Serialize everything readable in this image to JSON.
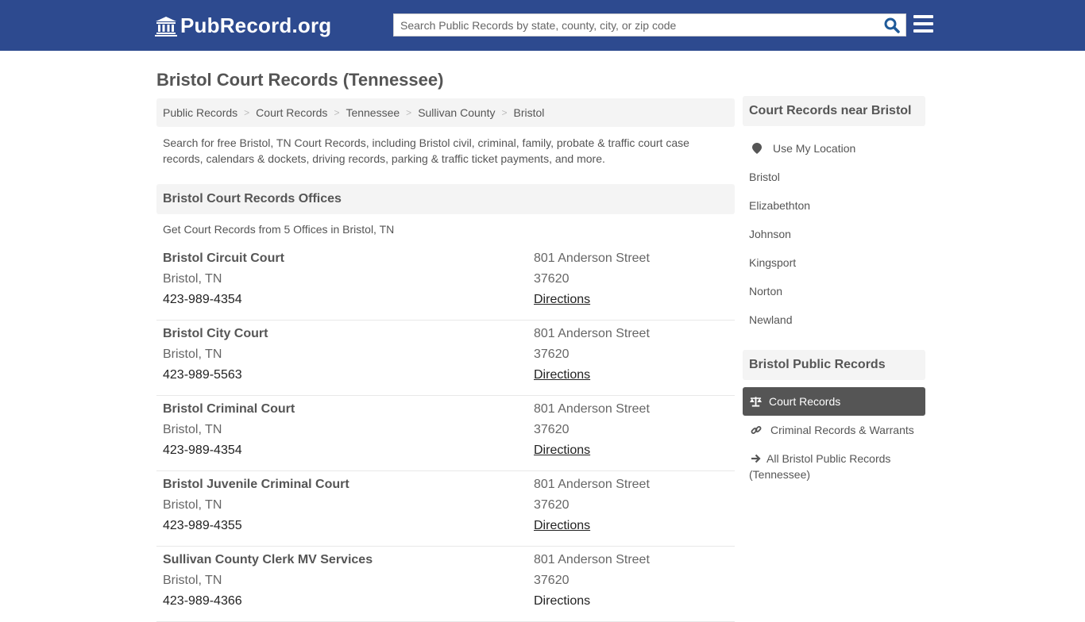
{
  "header": {
    "logo_text": "PubRecord.org",
    "search_placeholder": "Search Public Records by state, county, city, or zip code",
    "search_value": ""
  },
  "page": {
    "title": "Bristol Court Records (Tennessee)",
    "breadcrumb": [
      "Public Records",
      "Court Records",
      "Tennessee",
      "Sullivan County",
      "Bristol"
    ],
    "intro": "Search for free Bristol, TN Court Records, including Bristol civil, criminal, family, probate & traffic court case records, calendars & dockets, driving records, parking & traffic ticket payments, and more."
  },
  "offices_section": {
    "heading": "Bristol Court Records Offices",
    "count_text": "Get Court Records from 5 Offices in Bristol, TN",
    "offices": [
      {
        "name": "Bristol Circuit Court",
        "city": "Bristol, TN",
        "phone": "423-989-4354",
        "address": "801 Anderson Street",
        "zip": "37620",
        "directions": "Directions"
      },
      {
        "name": "Bristol City Court",
        "city": "Bristol, TN",
        "phone": "423-989-5563",
        "address": "801 Anderson Street",
        "zip": "37620",
        "directions": "Directions"
      },
      {
        "name": "Bristol Criminal Court",
        "city": "Bristol, TN",
        "phone": "423-989-4354",
        "address": "801 Anderson Street",
        "zip": "37620",
        "directions": "Directions"
      },
      {
        "name": "Bristol Juvenile Criminal Court",
        "city": "Bristol, TN",
        "phone": "423-989-4355",
        "address": "801 Anderson Street",
        "zip": "37620",
        "directions": "Directions"
      },
      {
        "name": "Sullivan County Clerk MV Services",
        "city": "Bristol, TN",
        "phone": "423-989-4366",
        "address": "801 Anderson Street",
        "zip": "37620",
        "directions": "Directions"
      }
    ]
  },
  "sidebar": {
    "nearby_heading": "Court Records near Bristol",
    "use_location": "Use My Location",
    "nearby": [
      "Bristol",
      "Elizabethton",
      "Johnson",
      "Kingsport",
      "Norton",
      "Newland"
    ],
    "public_heading": "Bristol Public Records",
    "active_link": "Court Records",
    "criminal_link": "Criminal Records & Warrants",
    "all_link": "All Bristol Public Records (Tennessee)"
  },
  "colors": {
    "header_bg": "#2d4a8f",
    "active_bg": "#555555",
    "search_icon": "#1f5a99"
  }
}
